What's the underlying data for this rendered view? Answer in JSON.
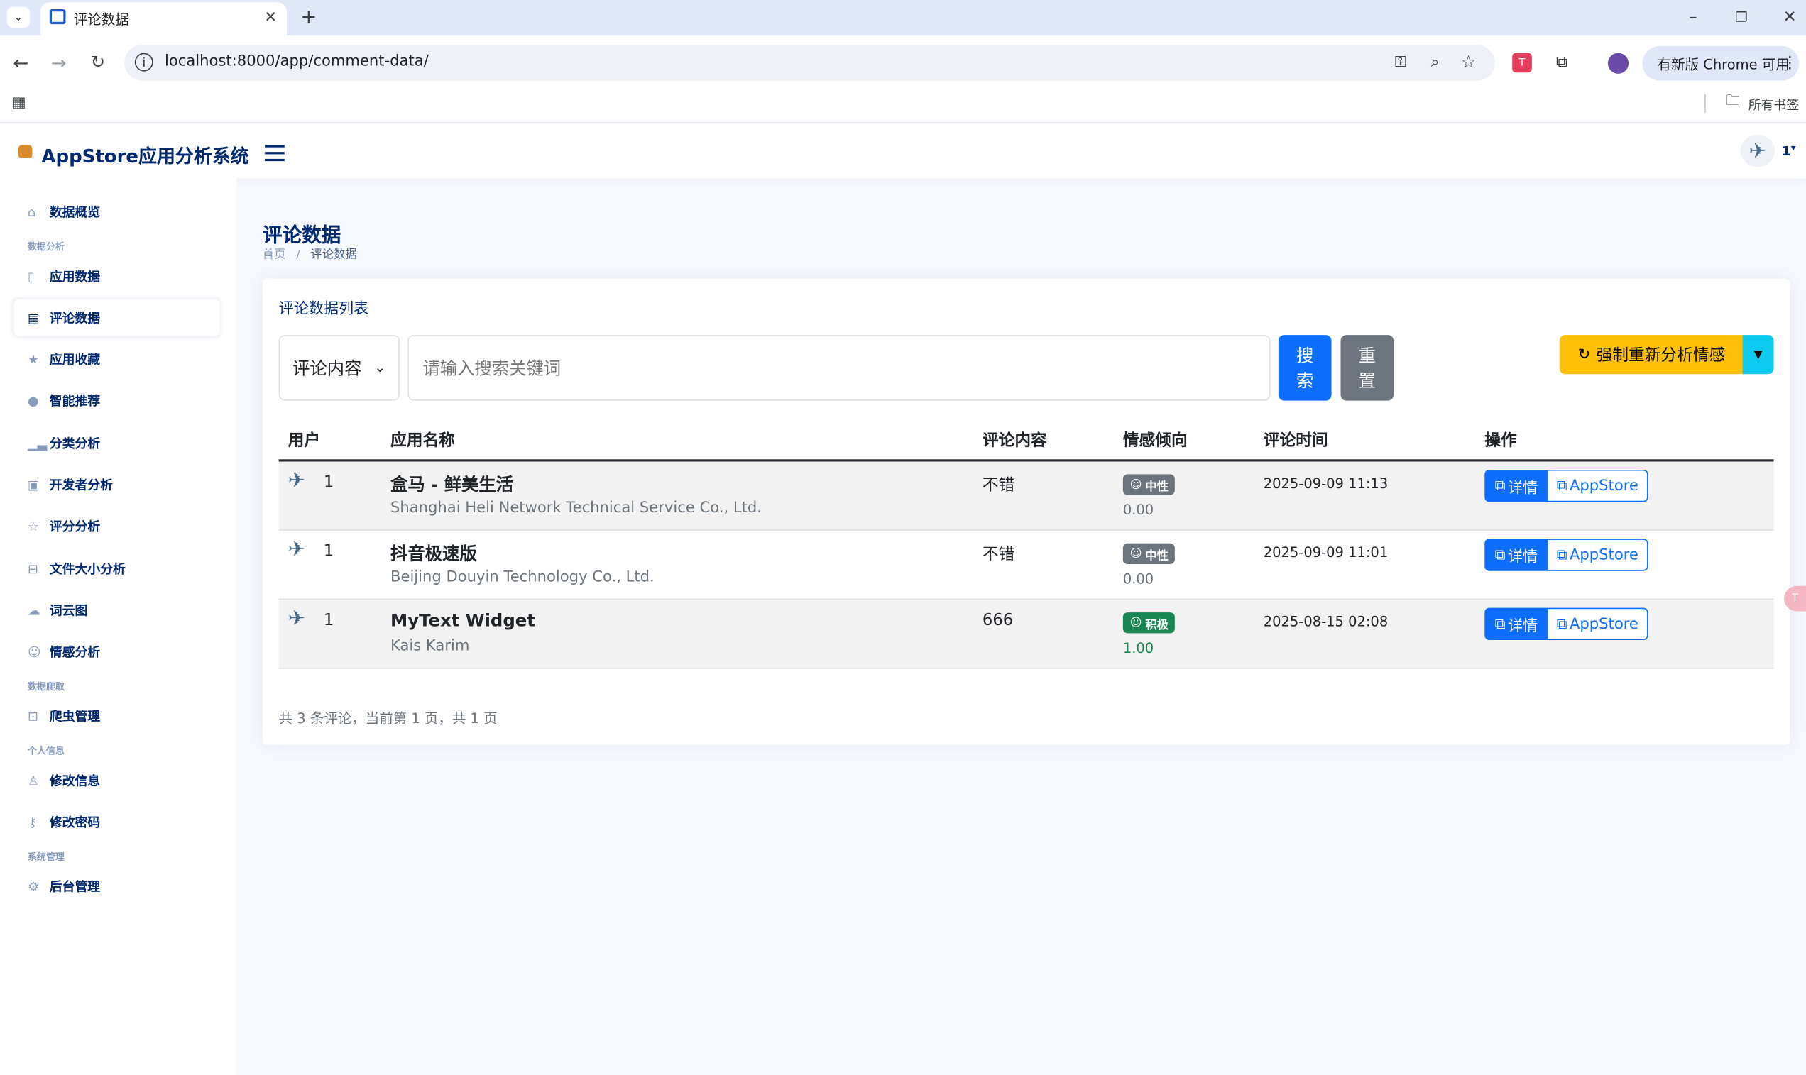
{
  "browser": {
    "tab_title": "评论数据",
    "url": "localhost:8000/app/comment-data/",
    "update_label": "有新版 Chrome 可用",
    "bookmarks_label": "所有书签"
  },
  "app": {
    "brand": "AppStore应用分析系统",
    "user_label": "1"
  },
  "sidebar": {
    "overview": "数据概览",
    "section_analysis": "数据分析",
    "app_data": "应用数据",
    "comment_data": "评论数据",
    "favorites": "应用收藏",
    "recommend": "智能推荐",
    "category": "分类分析",
    "developer": "开发者分析",
    "rating": "评分分析",
    "filesize": "文件大小分析",
    "wordcloud": "词云图",
    "sentiment": "情感分析",
    "section_crawl": "数据爬取",
    "crawler": "爬虫管理",
    "section_personal": "个人信息",
    "edit_info": "修改信息",
    "edit_password": "修改密码",
    "section_system": "系统管理",
    "admin": "后台管理"
  },
  "page": {
    "title": "评论数据",
    "breadcrumb_home": "首页",
    "breadcrumb_sep": "/",
    "breadcrumb_current": "评论数据",
    "card_title": "评论数据列表"
  },
  "search": {
    "field_selected": "评论内容",
    "placeholder": "请输入搜索关键词",
    "search_label": "搜索",
    "reset_label": "重置",
    "reanalyze_label": "强制重新分析情感"
  },
  "table": {
    "headers": [
      "用户",
      "应用名称",
      "评论内容",
      "情感倾向",
      "评论时间",
      "操作"
    ],
    "detail_label": "详情",
    "store_label": "AppStore",
    "rows": [
      {
        "user": "1",
        "app_name": "盒马 - 鲜美生活",
        "developer": "Shanghai Heli Network Technical Service Co., Ltd.",
        "content": "不错",
        "sentiment": "中性",
        "score": "0.00",
        "time": "2025-09-09 11:13"
      },
      {
        "user": "1",
        "app_name": "抖音极速版",
        "developer": "Beijing Douyin Technology Co., Ltd.",
        "content": "不错",
        "sentiment": "中性",
        "score": "0.00",
        "time": "2025-09-09 11:01"
      },
      {
        "user": "1",
        "app_name": "MyText Widget",
        "developer": "Kais Karim",
        "content": "666",
        "sentiment": "积极",
        "score": "1.00",
        "time": "2025-08-15 02:08"
      }
    ]
  },
  "summary": "共 3 条评论，当前第 1 页，共 1 页",
  "colors": {
    "primary": "#0d6efd",
    "neutral_badge": "#6c757d",
    "positive_badge": "#198754",
    "warning": "#ffc107",
    "info": "#0dcaf0",
    "brand": "#012970"
  }
}
